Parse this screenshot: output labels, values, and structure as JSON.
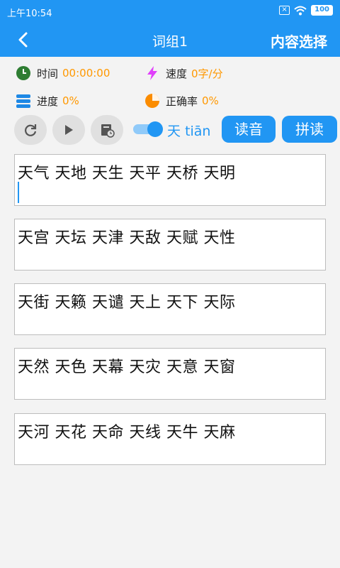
{
  "status": {
    "time": "上午10:54",
    "battery": "100"
  },
  "nav": {
    "title": "词组1",
    "right_label": "内容选择"
  },
  "stats": {
    "time_label": "时间",
    "time_value": "00:00:00",
    "speed_label": "速度",
    "speed_value": "0字/分",
    "progress_label": "进度",
    "progress_value": "0%",
    "accuracy_label": "正确率",
    "accuracy_value": "0%"
  },
  "controls": {
    "toggle_on": true,
    "current_char": "天",
    "current_pinyin": "tiān",
    "read_button": "读音",
    "spell_button": "拼读"
  },
  "cards": [
    {
      "text": "天气 天地 天生 天平 天桥 天明",
      "active": true
    },
    {
      "text": "天宫 天坛 天津 天敌 天赋 天性",
      "active": false
    },
    {
      "text": "天街 天籁 天谴 天上 天下 天际",
      "active": false
    },
    {
      "text": "天然 天色 天幕 天灾 天意 天窗",
      "active": false
    },
    {
      "text": "天河 天花 天命 天线 天牛 天麻",
      "active": false
    }
  ],
  "colors": {
    "primary": "#2196f3",
    "value": "#ff9800",
    "time_icon": "#2e7d32",
    "speed_icon": "#e040fb",
    "accuracy_icon": "#fb8c00"
  }
}
